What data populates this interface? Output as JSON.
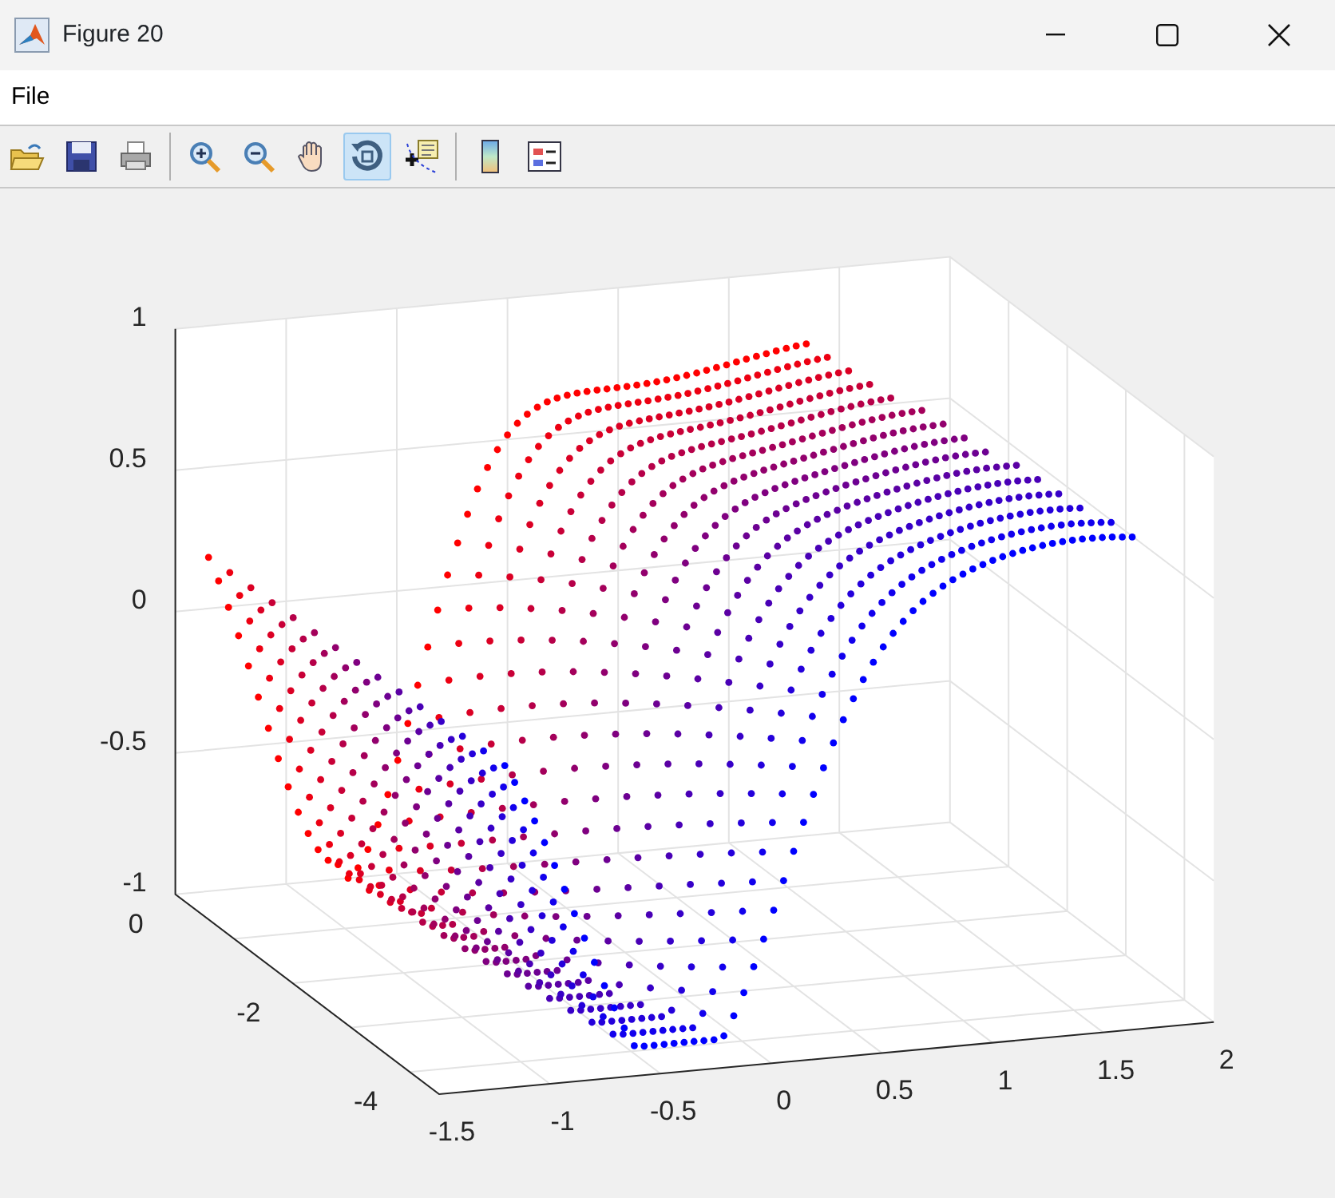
{
  "window": {
    "title": "Figure 20"
  },
  "menu": [
    "File"
  ],
  "toolbar_groups": [
    {
      "buttons": [
        {
          "kind": "open",
          "selected": false
        },
        {
          "kind": "save",
          "selected": false
        },
        {
          "kind": "print",
          "selected": false
        }
      ]
    },
    {
      "buttons": [
        {
          "kind": "zoom-in",
          "selected": false
        },
        {
          "kind": "zoom-out",
          "selected": false
        },
        {
          "kind": "pan",
          "selected": false
        },
        {
          "kind": "rotate",
          "selected": true
        },
        {
          "kind": "datatip",
          "selected": false
        }
      ]
    },
    {
      "buttons": [
        {
          "kind": "colorbar",
          "selected": false
        },
        {
          "kind": "legend",
          "selected": false
        }
      ]
    }
  ],
  "axes": {
    "z_ticks": [
      "1",
      "0.5",
      "0",
      "-0.5",
      "-1"
    ],
    "y_ticks": [
      "0",
      "-2",
      "-4"
    ],
    "x_ticks": [
      "-1.5",
      "-1",
      "-0.5",
      "0",
      "0.5",
      "1",
      "1.5",
      "2"
    ]
  }
}
